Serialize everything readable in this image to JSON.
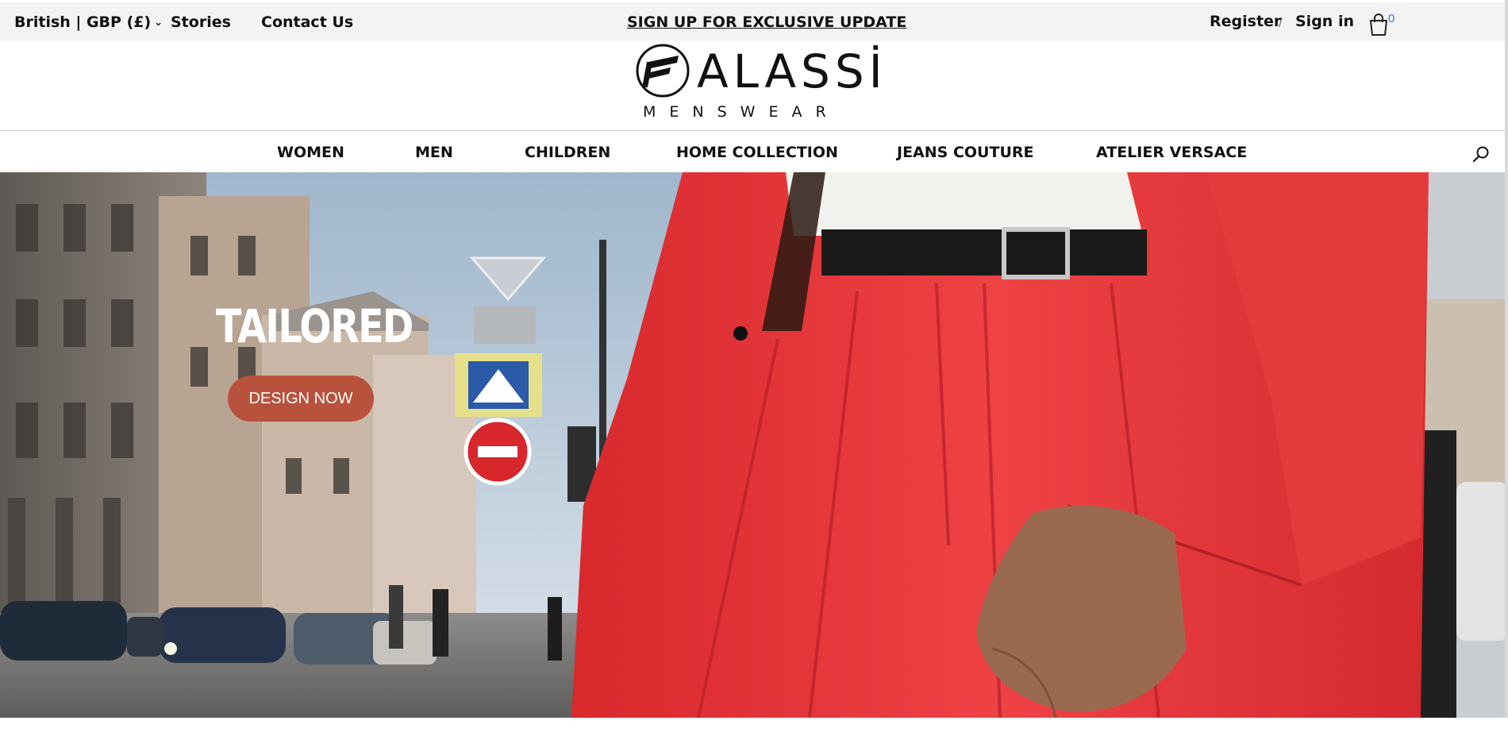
{
  "topbar": {
    "locale": "British | GBP (£)",
    "stories": "Stories",
    "contact": "Contact Us",
    "promo": "SIGN UP FOR EXCLUSIVE UPDATE",
    "register": "Register",
    "separator": "/",
    "signin": "Sign in",
    "cart_count": "0"
  },
  "logo": {
    "wordmark": "ALASSİ",
    "subline": "MENSWEAR"
  },
  "nav": {
    "items": [
      "WOMEN",
      "MEN",
      "CHILDREN",
      "HOME COLLECTION",
      "JEANS COUTURE",
      "ATELIER VERSACE"
    ]
  },
  "hero": {
    "title": "TAILORED",
    "button": "DESIGN NOW"
  },
  "colors": {
    "topbar_bg": "#f3f3f3",
    "button_bg": "#b9523c",
    "suit_red": "#e8383a",
    "cart_count": "#2a7de1"
  },
  "icons": {
    "locale": "chevron-down-icon",
    "cart": "shopping-bag-icon",
    "search": "search-icon",
    "logo": "falassi-f-monogram-icon"
  }
}
